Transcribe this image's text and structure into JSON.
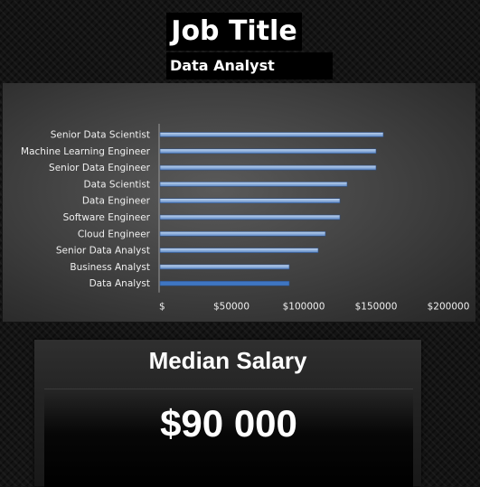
{
  "header": {
    "title": "Job Title",
    "selected_job": "Data Analyst"
  },
  "median": {
    "label": "Median Salary",
    "value": "$90 000"
  },
  "colors": {
    "bar_top": "#c5d9f1",
    "bar_bottom": "#5b87c5",
    "bar_highlight": "#3f76c2"
  },
  "chart_data": {
    "type": "bar",
    "orientation": "horizontal",
    "categories": [
      "Senior Data Scientist",
      "Machine Learning Engineer",
      "Senior Data Engineer",
      "Data Scientist",
      "Data Engineer",
      "Software Engineer",
      "Cloud Engineer",
      "Senior Data Analyst",
      "Business Analyst",
      "Data Analyst"
    ],
    "values": [
      155000,
      150000,
      150000,
      130000,
      125000,
      125000,
      115000,
      110000,
      90000,
      90000
    ],
    "xlim": [
      0,
      200000
    ],
    "ticks": [
      0,
      50000,
      100000,
      150000,
      200000
    ],
    "tick_labels": [
      "$",
      "$50000",
      "$100000",
      "$150000",
      "$200000"
    ],
    "highlighted": "Data Analyst",
    "grid": false
  }
}
